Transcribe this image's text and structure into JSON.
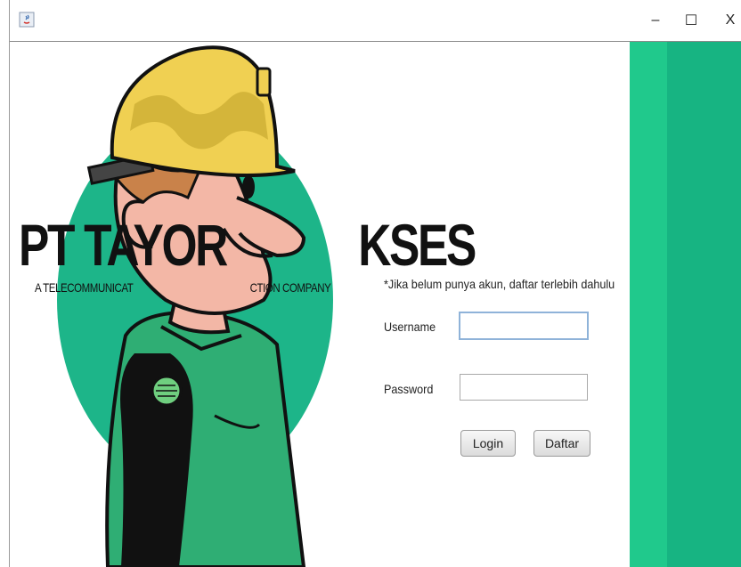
{
  "window": {
    "minimize_glyph": "–",
    "maximize_glyph": "☐",
    "close_glyph": "X"
  },
  "branding": {
    "company_name": "PT TAYOR",
    "company_name_tail": "KSES",
    "tagline_start": "A TELECOMMUNICAT",
    "tagline_end": "CTION COMPANY"
  },
  "form": {
    "notice": "*Jika belum punya akun, daftar terlebih dahulu",
    "username_label": "Username",
    "username_value": "",
    "password_label": "Password",
    "password_value": "",
    "login_button": "Login",
    "register_button": "Daftar"
  },
  "colors": {
    "panel_green": "#20c98c",
    "panel_stripe": "#17b482",
    "circle_green": "#1db589",
    "helmet_yellow": "#f0d052",
    "shirt_green": "#2fae74"
  },
  "icons": {
    "app_icon": "java-app-icon"
  }
}
